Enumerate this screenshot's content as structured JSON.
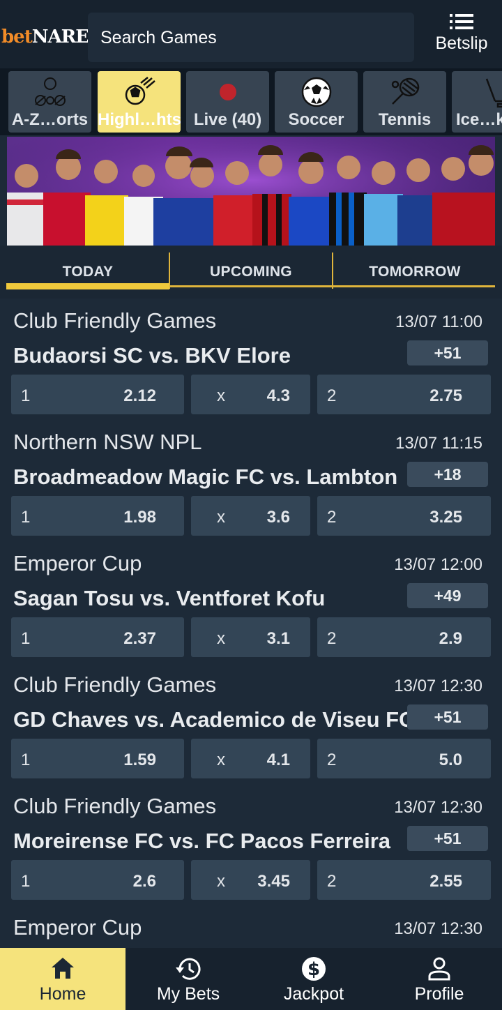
{
  "header": {
    "logo_part1": "bet",
    "logo_part2": "NARE",
    "search_placeholder": "Search Games",
    "betslip_label": "Betslip"
  },
  "sports": [
    {
      "label": "A-Z…orts",
      "icon": "sports-balls-icon",
      "active": false
    },
    {
      "label": "Highl…hts",
      "icon": "flying-ball-icon",
      "active": true
    },
    {
      "label": "Live (40)",
      "icon": "live-dot-icon",
      "active": false
    },
    {
      "label": "Soccer",
      "icon": "soccer-ball-icon",
      "active": false
    },
    {
      "label": "Tennis",
      "icon": "tennis-racket-icon",
      "active": false
    },
    {
      "label": "Ice…k",
      "icon": "ice-hockey-icon",
      "active": false
    }
  ],
  "tabs": [
    {
      "label": "TODAY",
      "active": true
    },
    {
      "label": "UPCOMING",
      "active": false
    },
    {
      "label": "TOMORROW",
      "active": false
    }
  ],
  "matches": [
    {
      "league": "Club Friendly Games",
      "time": "13/07 11:00",
      "teams": "Budaorsi SC vs. BKV Elore",
      "more": "+51",
      "odds": [
        {
          "key": "1",
          "value": "2.12"
        },
        {
          "key": "x",
          "value": "4.3"
        },
        {
          "key": "2",
          "value": "2.75"
        }
      ]
    },
    {
      "league": "Northern NSW NPL",
      "time": "13/07 11:15",
      "teams": "Broadmeadow Magic FC vs. Lambton",
      "more": "+18",
      "odds": [
        {
          "key": "1",
          "value": "1.98"
        },
        {
          "key": "x",
          "value": "3.6"
        },
        {
          "key": "2",
          "value": "3.25"
        }
      ]
    },
    {
      "league": "Emperor Cup",
      "time": "13/07 12:00",
      "teams": "Sagan Tosu vs. Ventforet Kofu",
      "more": "+49",
      "odds": [
        {
          "key": "1",
          "value": "2.37"
        },
        {
          "key": "x",
          "value": "3.1"
        },
        {
          "key": "2",
          "value": "2.9"
        }
      ]
    },
    {
      "league": "Club Friendly Games",
      "time": "13/07 12:30",
      "teams": "GD Chaves vs. Academico de Viseu FC",
      "more": "+51",
      "odds": [
        {
          "key": "1",
          "value": "1.59"
        },
        {
          "key": "x",
          "value": "4.1"
        },
        {
          "key": "2",
          "value": "5.0"
        }
      ]
    },
    {
      "league": "Club Friendly Games",
      "time": "13/07 12:30",
      "teams": "Moreirense FC vs. FC Pacos Ferreira",
      "more": "+51",
      "odds": [
        {
          "key": "1",
          "value": "2.6"
        },
        {
          "key": "x",
          "value": "3.45"
        },
        {
          "key": "2",
          "value": "2.55"
        }
      ]
    },
    {
      "league": "Emperor Cup",
      "time": "13/07 12:30"
    }
  ],
  "bottom_nav": [
    {
      "label": "Home",
      "icon": "home-icon",
      "active": true
    },
    {
      "label": "My Bets",
      "icon": "history-icon",
      "active": false
    },
    {
      "label": "Jackpot",
      "icon": "dollar-coin-icon",
      "active": false
    },
    {
      "label": "Profile",
      "icon": "profile-icon",
      "active": false
    }
  ],
  "colors": {
    "background": "#1d2a38",
    "accent_yellow": "#f5e37c",
    "tab_underline": "#e0b53c",
    "odds_bg": "#334556"
  }
}
